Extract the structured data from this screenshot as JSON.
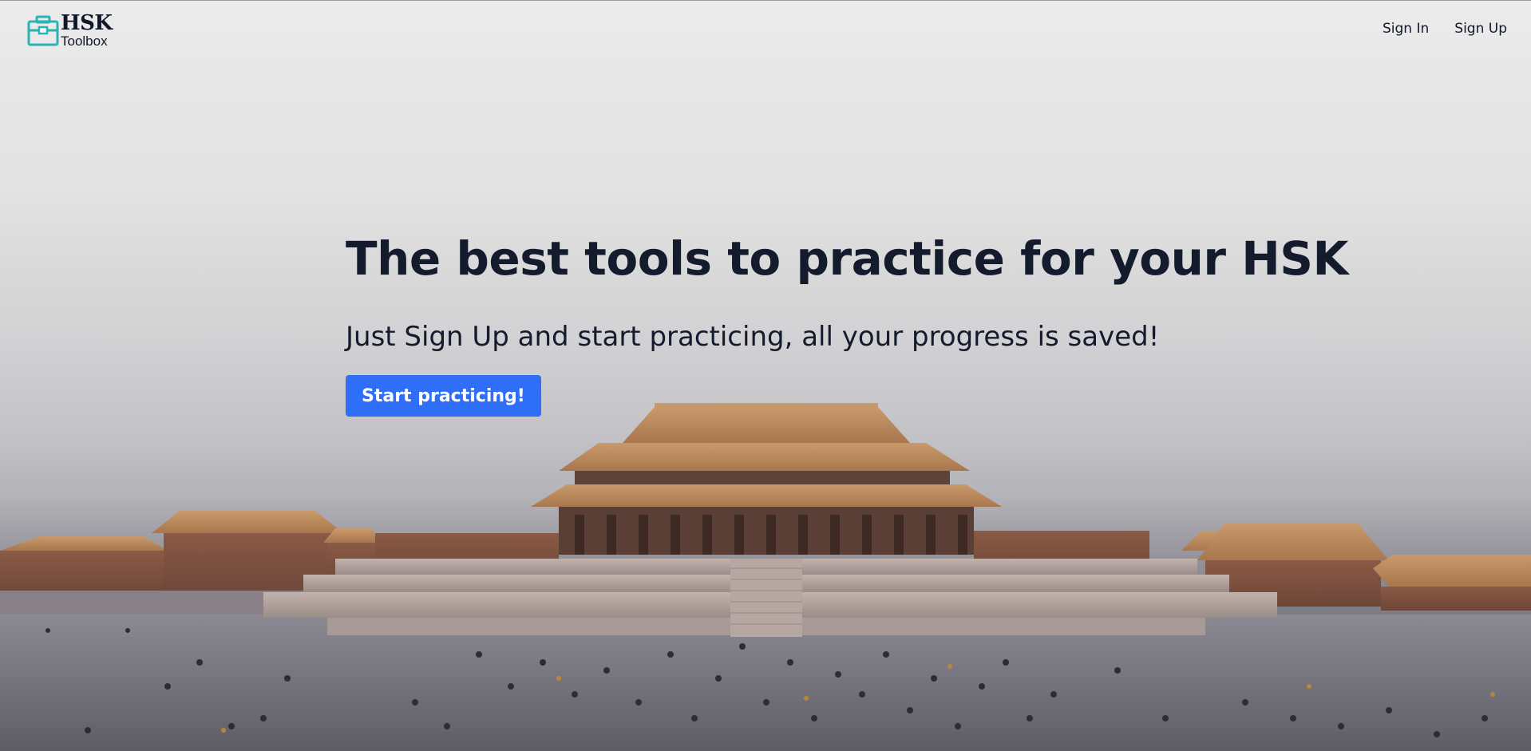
{
  "header": {
    "logo_title": "HSK",
    "logo_subtitle": "Toolbox",
    "nav": {
      "sign_in": "Sign In",
      "sign_up": "Sign Up"
    }
  },
  "hero": {
    "title": "The best tools to practice for your HSK",
    "subtitle": "Just Sign Up and start practicing, all your progress is saved!",
    "cta_label": "Start practicing!"
  },
  "colors": {
    "accent": "#2f6ff7",
    "text": "#141b2d",
    "logo_icon": "#2bb3b3"
  },
  "icons": {
    "logo": "toolbox-icon"
  },
  "background": {
    "description_icon": "forbidden-city-photo"
  }
}
